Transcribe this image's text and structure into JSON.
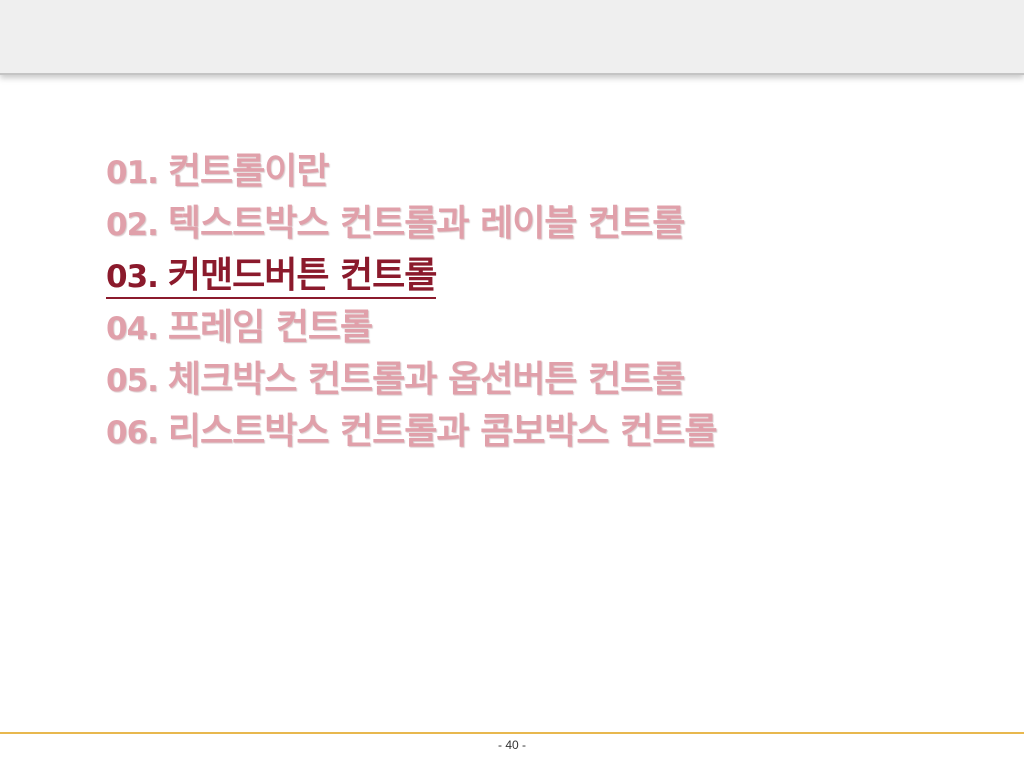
{
  "toc": {
    "items": [
      {
        "num": "01.",
        "label": "컨트롤이란",
        "active": false
      },
      {
        "num": "02.",
        "label": "텍스트박스 컨트롤과 레이블 컨트롤",
        "active": false
      },
      {
        "num": "03.",
        "label": "커맨드버튼 컨트롤",
        "active": true
      },
      {
        "num": "04.",
        "label": "프레임 컨트롤",
        "active": false
      },
      {
        "num": "05.",
        "label": "체크박스 컨트롤과 옵션버튼 컨트롤",
        "active": false
      },
      {
        "num": "06.",
        "label": "리스트박스 컨트롤과 콤보박스 컨트롤",
        "active": false
      }
    ]
  },
  "footer": {
    "page_number": "- 40 -"
  },
  "colors": {
    "inactive_text": "#e0a0aa",
    "active_text": "#8b1a2c",
    "footer_rule": "#e8b84f"
  }
}
